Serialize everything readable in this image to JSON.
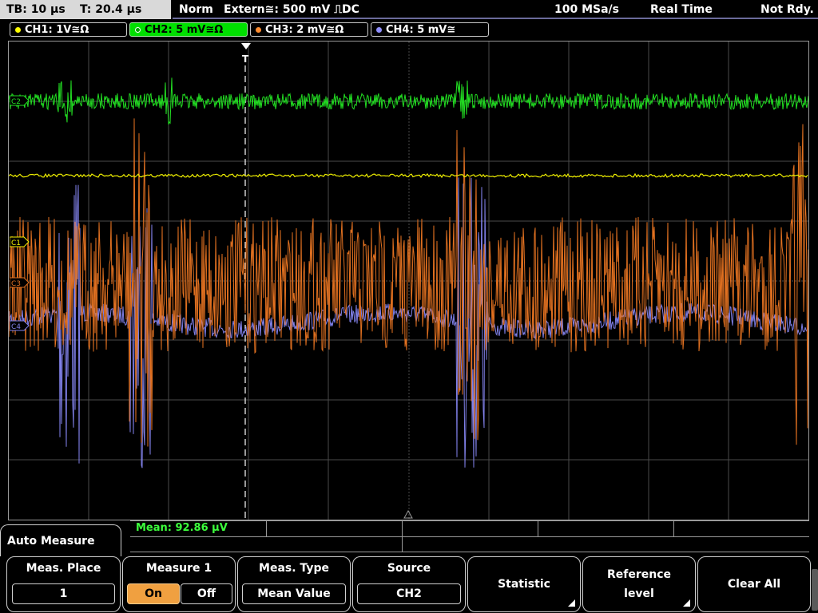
{
  "top_bar": {
    "timebase": "TB: 10 µs",
    "trigger_time": "T: 20.4 µs",
    "mode": "Norm",
    "trigger_source": "Extern≅: 500 mV ⎍DC",
    "sample_rate": "100 MSa/s",
    "acquisition": "Real Time",
    "status": "Not Rdy."
  },
  "channels": [
    {
      "label": "CH1: 1V≅Ω",
      "color": "#ffff00",
      "active": false
    },
    {
      "label": "CH2: 5 mV≅Ω",
      "color": "#00ff00",
      "active": true
    },
    {
      "label": "CH3: 2 mV≅Ω",
      "color": "#ff8c30",
      "active": false
    },
    {
      "label": "CH4: 5 mV≅",
      "color": "#9090ff",
      "active": false
    }
  ],
  "markers": {
    "ch2": "C2",
    "ch1": "C1",
    "ch3": "C3",
    "ch4": "C4",
    "trigger": "T"
  },
  "measurement": {
    "mean_readout": "Mean: 92.86 µV"
  },
  "softkeys": {
    "menu_title": "Auto Measure",
    "meas_place": {
      "title": "Meas. Place",
      "value": "1"
    },
    "measure1": {
      "title": "Measure 1",
      "on": "On",
      "off": "Off",
      "selected": "On"
    },
    "meas_type": {
      "title": "Meas. Type",
      "value": "Mean Value"
    },
    "source": {
      "title": "Source",
      "value": "CH2"
    },
    "statistic": {
      "label": "Statistic"
    },
    "reference_level": {
      "line1": "Reference",
      "line2": "level"
    },
    "clear_all": {
      "label": "Clear All"
    }
  },
  "colors": {
    "ch1": "#f0f000",
    "ch2": "#22dd22",
    "ch3": "#e07020",
    "ch4": "#8080e8",
    "grid": "#5a5a5a"
  }
}
